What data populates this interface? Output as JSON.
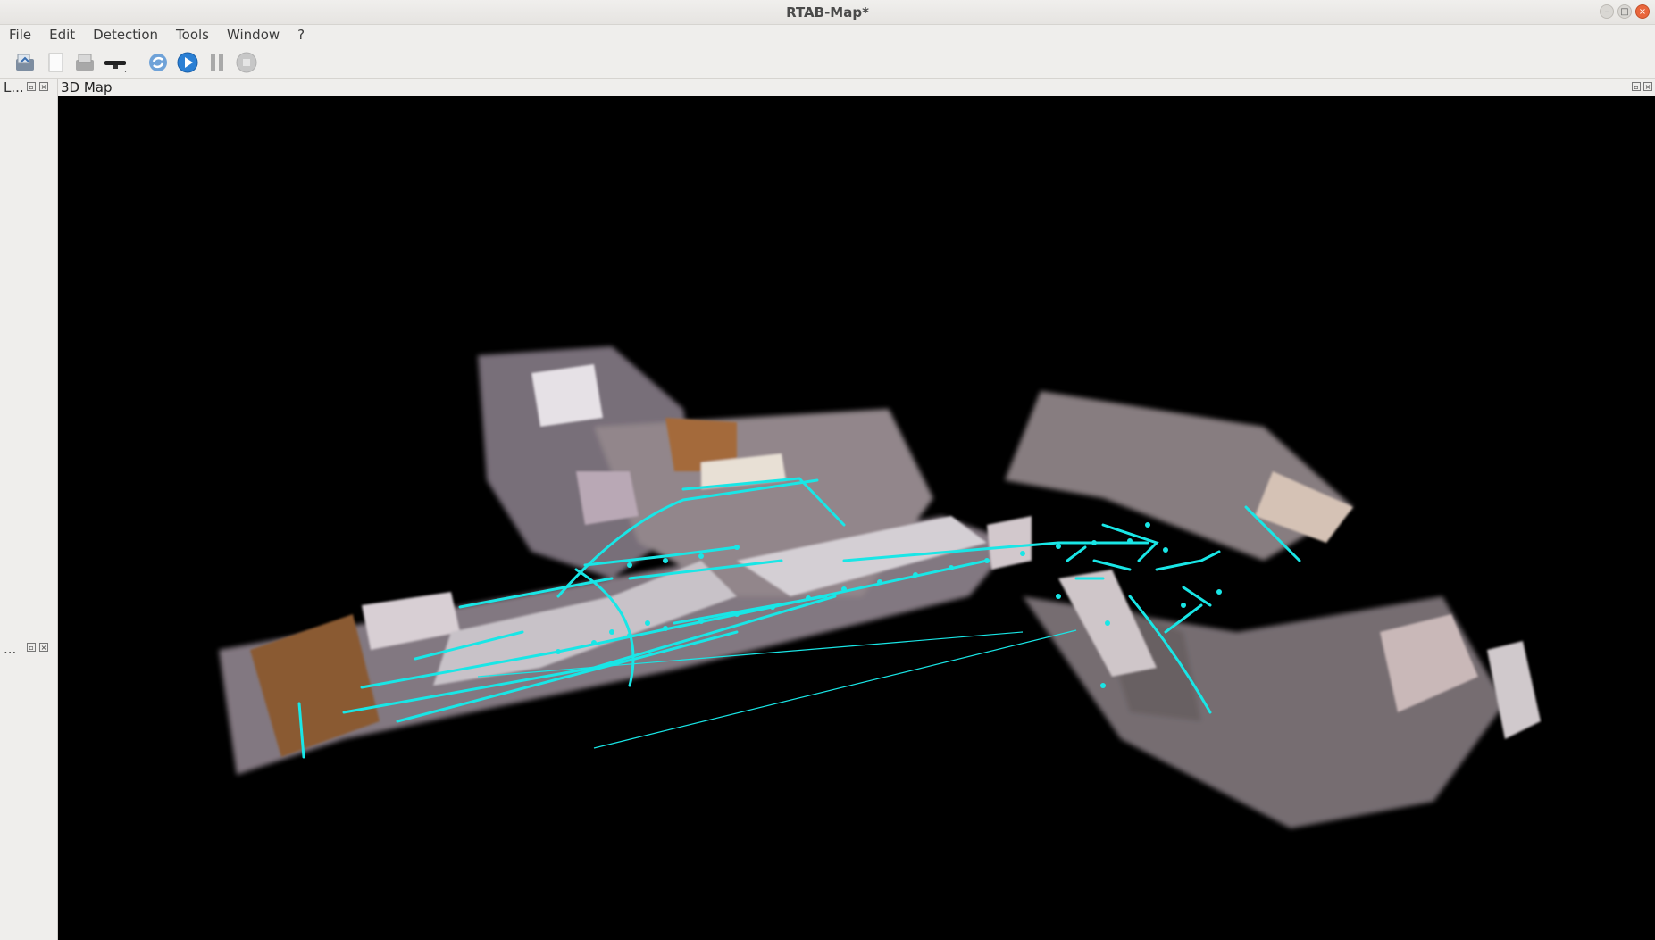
{
  "window": {
    "title": "RTAB-Map*"
  },
  "menu": [
    "File",
    "Edit",
    "Detection",
    "Tools",
    "Window",
    "?"
  ],
  "toolbar": {
    "icons": [
      "open-database-icon",
      "new-database-icon",
      "close-database-icon",
      "camera-source-icon",
      "refresh-icon",
      "play-icon",
      "pause-icon",
      "stop-icon"
    ]
  },
  "docks": {
    "top_title": "L...",
    "bottom_title": "...",
    "map_title": "3D Map"
  },
  "colors": {
    "trajectory": "#19e6e6",
    "viewer_bg": "#000000",
    "window_bg": "#efeeec"
  }
}
